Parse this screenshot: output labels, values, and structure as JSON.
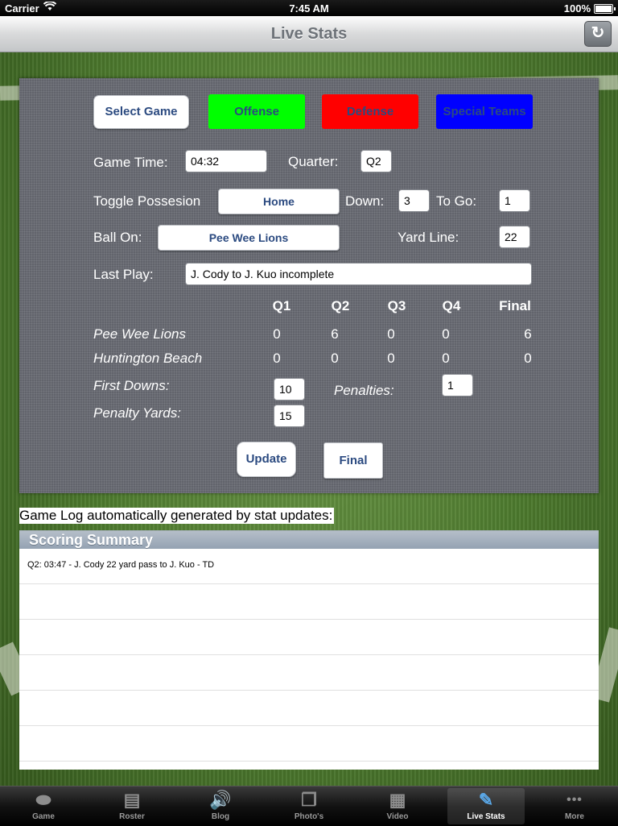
{
  "status_bar": {
    "carrier": "Carrier",
    "time": "7:45 AM",
    "battery": "100%"
  },
  "nav": {
    "title": "Live Stats",
    "refresh_icon": "↻"
  },
  "panel": {
    "select_game": "Select Game",
    "offense": "Offense",
    "defense": "Defense",
    "special_teams": "Special Teams",
    "colors": {
      "offense": "#00ff00",
      "defense": "#ff0000",
      "special_teams": "#0000ff"
    },
    "game_time_label": "Game Time:",
    "game_time_value": "04:32",
    "quarter_label": "Quarter:",
    "quarter_value": "Q2",
    "toggle_possession_label": "Toggle Possesion",
    "possession_value": "Home",
    "down_label": "Down:",
    "down_value": "3",
    "to_go_label": "To Go:",
    "to_go_value": "1",
    "ball_on_label": "Ball On:",
    "ball_on_value": "Pee Wee  Lions",
    "yard_line_label": "Yard Line:",
    "yard_line_value": "22",
    "last_play_label": "Last Play:",
    "last_play_value": "J. Cody to J. Kuo incomplete",
    "score_headers": [
      "Q1",
      "Q2",
      "Q3",
      "Q4",
      "Final"
    ],
    "teams": [
      {
        "name": "Pee Wee  Lions",
        "scores": [
          "0",
          "6",
          "0",
          "0",
          "6"
        ]
      },
      {
        "name": "Huntington Beach",
        "scores": [
          "0",
          "0",
          "0",
          "0",
          "0"
        ]
      }
    ],
    "first_downs_label": "First Downs:",
    "first_downs_value": "10",
    "penalties_label": "Penalties:",
    "penalties_value": "1",
    "penalty_yards_label": "Penalty Yards:",
    "penalty_yards_value": "15",
    "update": "Update",
    "final": "Final"
  },
  "game_log": {
    "caption": "Game Log automatically generated by stat updates:",
    "header": "Scoring Summary",
    "rows": [
      "Q2: 03:47 - J. Cody 22 yard pass to  J. Kuo - TD",
      "",
      "",
      "",
      "",
      ""
    ]
  },
  "tabs": [
    {
      "label": "Game",
      "icon": "football-icon",
      "glyph": "⬬"
    },
    {
      "label": "Roster",
      "icon": "document-icon",
      "glyph": "▤"
    },
    {
      "label": "Blog",
      "icon": "speaker-icon",
      "glyph": "🔊"
    },
    {
      "label": "Photo's",
      "icon": "photos-icon",
      "glyph": "❐"
    },
    {
      "label": "Video",
      "icon": "film-icon",
      "glyph": "▦"
    },
    {
      "label": "Live Stats",
      "icon": "edit-icon",
      "glyph": "✎",
      "active": true
    },
    {
      "label": "More",
      "icon": "more-icon",
      "glyph": "•••"
    }
  ]
}
